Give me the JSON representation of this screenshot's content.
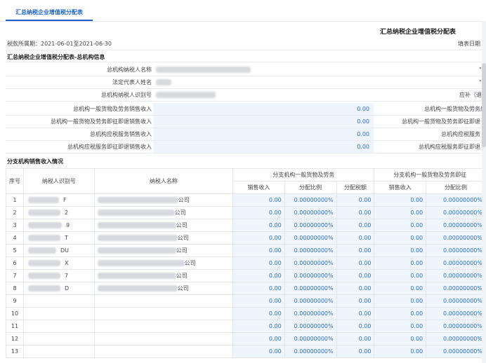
{
  "tab": "汇总纳税企业增值税分配表",
  "title": "汇总纳税企业增值税分配表",
  "period": "税款所属期：2021-06-01至2021-06-30",
  "fill_date": "填表日期",
  "sec1": "汇总纳税企业增值税分配表-总机构信息",
  "hq_fields": [
    {
      "label": "总机构纳税人名称",
      "right": "\""
    },
    {
      "label": "法定代表人姓名",
      "right": "\""
    },
    {
      "label": "总机构纳税人识别号",
      "right": "应补（退"
    }
  ],
  "hq_amounts": [
    {
      "label": "总机构一般货物及劳务销售收入",
      "value": "0.00",
      "right": "总机构一般货物及劳务应"
    },
    {
      "label": "总机构一般货物及劳务即征即退销售收入",
      "value": "0.00",
      "right": "总机构一般货物及劳务即征即退"
    },
    {
      "label": "总机构应税服务销售收入",
      "value": "0.00",
      "right": "总机构应税服务"
    },
    {
      "label": "总机构应税服务即征即退销售收入",
      "value": "0.00",
      "right": "总机构应税服务即征即退"
    }
  ],
  "sec2": "分支机构销售收入情况",
  "table": {
    "h_seq": "序号",
    "h_id": "纳税人识别号",
    "h_name": "纳税人名称",
    "h_group1": "分支机构一般货物及劳务",
    "h_group2": "分支机构一般货物及劳务即征",
    "h_sub": [
      "销售收入",
      "分配比例",
      "分配税额",
      "销售收入",
      "分配比例"
    ],
    "rows": [
      {
        "no": "1",
        "id_tail": "F",
        "name_tail": "公司",
        "vals": [
          "0.00",
          "0.00000000%",
          "0.00",
          "0.00",
          "0.00000000%"
        ]
      },
      {
        "no": "2",
        "id_tail": "2",
        "name_tail": "公司",
        "vals": [
          "0.00",
          "0.00000000%",
          "0.00",
          "0.00",
          "0.00000000%"
        ]
      },
      {
        "no": "3",
        "id_tail": "9",
        "name_tail": "公司",
        "vals": [
          "0.00",
          "0.00000000%",
          "0.00",
          "0.00",
          "0.00000000%"
        ]
      },
      {
        "no": "4",
        "id_tail": "T",
        "name_tail": "公司",
        "vals": [
          "0.00",
          "0.00000000%",
          "0.00",
          "0.00",
          "0.00000000%"
        ]
      },
      {
        "no": "5",
        "id_tail": "DU",
        "name_tail": "公司",
        "vals": [
          "0.00",
          "0.00000000%",
          "0.00",
          "0.00",
          "0.00000000%"
        ]
      },
      {
        "no": "6",
        "id_tail": "X",
        "name_tail": "公司",
        "vals": [
          "0.00",
          "0.00000000%",
          "0.00",
          "0.00",
          "0.00000000%"
        ]
      },
      {
        "no": "7",
        "id_tail": "7",
        "name_tail": "公司",
        "vals": [
          "0.00",
          "0.00000000%",
          "0.00",
          "0.00",
          "0.00000000%"
        ]
      },
      {
        "no": "8",
        "id_tail": "D",
        "name_tail": "公司",
        "vals": [
          "0.00",
          "0.00000000%",
          "0.00",
          "0.00",
          "0.00000000%"
        ]
      },
      {
        "no": "9",
        "id_tail": "",
        "name_tail": "",
        "vals": [
          "0.00",
          "0.00000000%",
          "0.00",
          "0.00",
          "0.00000000%"
        ]
      },
      {
        "no": "10",
        "id_tail": "",
        "name_tail": "",
        "vals": [
          "0.00",
          "0.00000000%",
          "0.00",
          "0.00",
          "0.00000000%"
        ]
      },
      {
        "no": "11",
        "id_tail": "",
        "name_tail": "",
        "vals": [
          "0.00",
          "0.00000000%",
          "0.00",
          "0.00",
          "0.00000000%"
        ]
      },
      {
        "no": "12",
        "id_tail": "",
        "name_tail": "",
        "vals": [
          "0.00",
          "0.00000000%",
          "0.00",
          "0.00",
          "0.00000000%"
        ]
      },
      {
        "no": "13",
        "id_tail": "",
        "name_tail": "",
        "vals": [
          "0.00",
          "0.00000000%",
          "0.00",
          "0.00",
          "0.00000000%"
        ]
      }
    ]
  },
  "colors": {
    "accent": "#1a63c5",
    "value": "#2a6fcf",
    "value_bg": "#eef5fc"
  }
}
